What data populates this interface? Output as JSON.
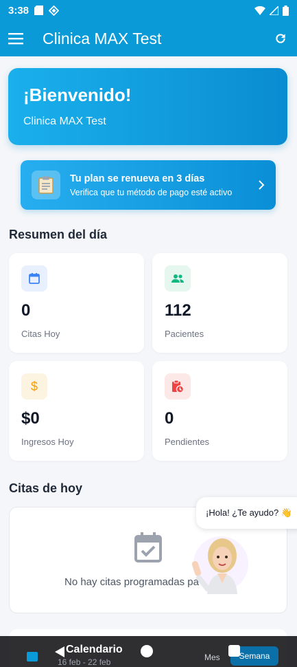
{
  "status": {
    "time": "3:38"
  },
  "appbar": {
    "title": "Clinica MAX Test"
  },
  "welcome": {
    "heading": "¡Bienvenido!",
    "clinic": "Clinica MAX Test"
  },
  "plan": {
    "title": "Tu plan se renueva en 3 días",
    "subtitle": "Verifica que tu método de pago esté activo"
  },
  "summary": {
    "title": "Resumen del día",
    "cards": [
      {
        "value": "0",
        "label": "Citas Hoy",
        "icon": "calendar-icon",
        "color": "#3b82f6",
        "bg": "#e8f0fe"
      },
      {
        "value": "112",
        "label": "Pacientes",
        "icon": "people-icon",
        "color": "#10b981",
        "bg": "#e6f7ef"
      },
      {
        "value": "$0",
        "label": "Ingresos Hoy",
        "icon": "dollar-icon",
        "color": "#f59e0b",
        "bg": "#fdf3e1"
      },
      {
        "value": "0",
        "label": "Pendientes",
        "icon": "clipboard-clock-icon",
        "color": "#ef4444",
        "bg": "#fde8e8"
      }
    ]
  },
  "appointments": {
    "title": "Citas de hoy",
    "empty": "No hay citas programadas pa"
  },
  "assistant": {
    "greeting": "¡Hola! ¿Te ayudo? 👋"
  },
  "calendar": {
    "title": "Calendario",
    "range": "16 feb - 22 feb",
    "month_label": "Mes",
    "week_label": "Semana"
  }
}
